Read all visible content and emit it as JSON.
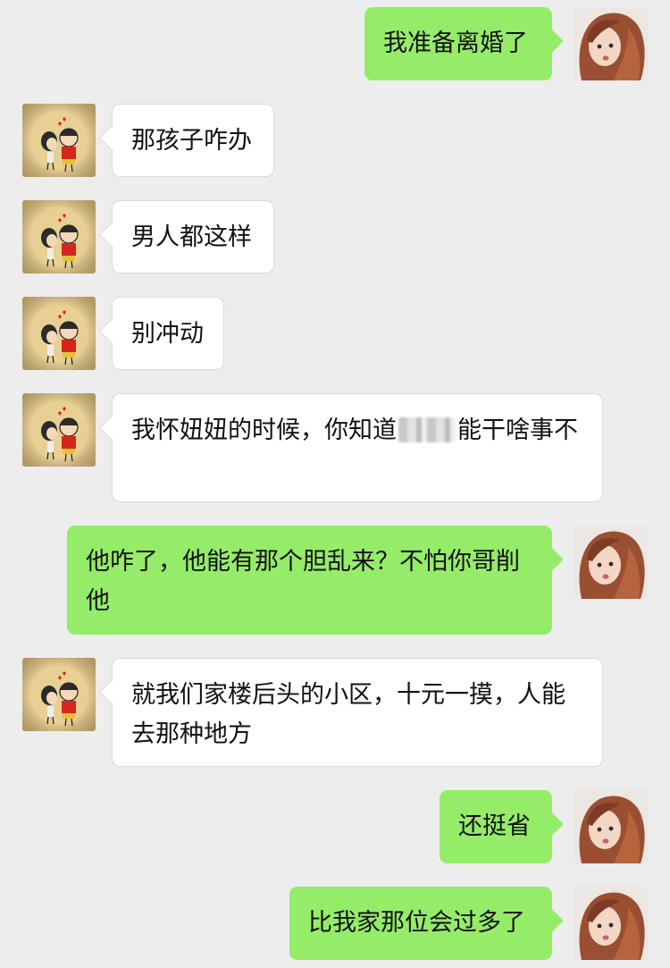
{
  "chat": {
    "messages": [
      {
        "side": "right",
        "text": "我准备离婚了",
        "avatar": "woman-avatar"
      },
      {
        "side": "left",
        "text": "那孩子咋办",
        "avatar": "crayon-shin-chan-avatar"
      },
      {
        "side": "left",
        "text": "男人都这样",
        "avatar": "crayon-shin-chan-avatar"
      },
      {
        "side": "left",
        "text": "别冲动",
        "avatar": "crayon-shin-chan-avatar"
      },
      {
        "side": "left",
        "text_before": "我怀妞妞的时候，你知道",
        "text_after": "能干啥事不",
        "redacted": true,
        "avatar": "crayon-shin-chan-avatar"
      },
      {
        "side": "right",
        "text": "他咋了，他能有那个胆乱来？不怕你哥削他",
        "avatar": "woman-avatar"
      },
      {
        "side": "left",
        "text": "就我们家楼后头的小区，十元一摸，人能去那种地方",
        "avatar": "crayon-shin-chan-avatar"
      },
      {
        "side": "right",
        "text": "还挺省",
        "avatar": "woman-avatar"
      },
      {
        "side": "right",
        "text": "比我家那位会过多了",
        "avatar": "woman-avatar"
      }
    ]
  },
  "colors": {
    "background": "#ededed",
    "outgoing_bubble": "#95ec69",
    "incoming_bubble": "#ffffff"
  }
}
